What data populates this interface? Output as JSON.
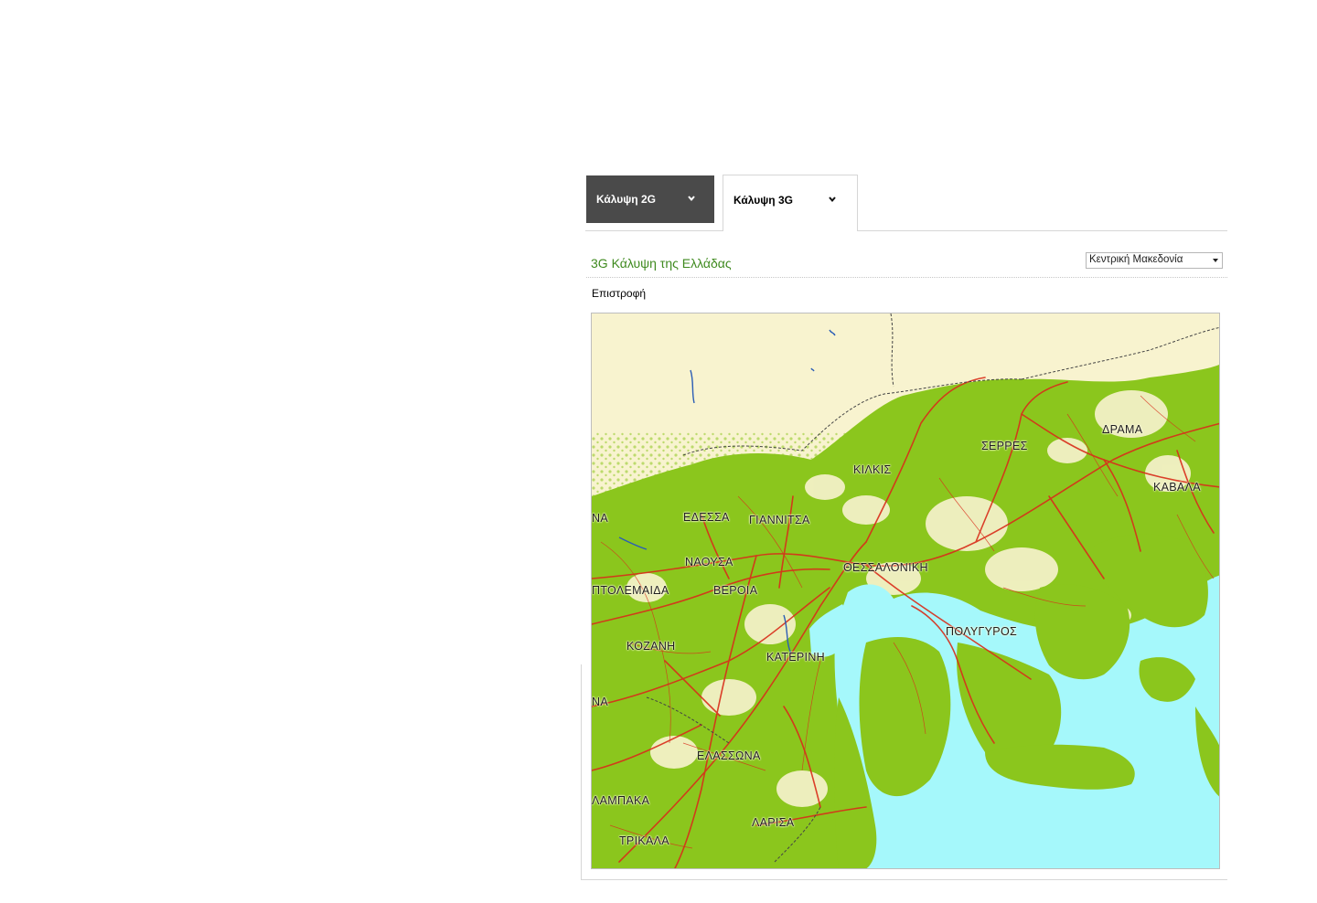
{
  "tabs": [
    {
      "label": "Κάλυψη 2G",
      "active": false
    },
    {
      "label": "Κάλυψη 3G",
      "active": true
    }
  ],
  "content": {
    "title": "3G Κάλυψη της Ελλάδας",
    "region_select": {
      "selected": "Κεντρική Μακεδονία"
    },
    "back_link": "Επιστροφή"
  },
  "map": {
    "colors": {
      "land": "#f8f3cf",
      "coverage": "#8bc61d",
      "sea": "#a5f8fb",
      "roads": "#d92d1a",
      "borders": "#444444",
      "lakes": "#2b5db5"
    },
    "labels": {
      "drama": "ΔΡΑΜΑ",
      "serres": "ΣΕΡΡΕΣ",
      "kilkis": "ΚΙΛΚΙΣ",
      "kavala": "ΚΑΒΑΛΑ",
      "na_top": "ΝΑ",
      "edessa": "ΕΔΕΣΣΑ",
      "giannitsa": "ΓΙΑΝΝΙΤΣΑ",
      "naousa": "ΝΑΟΥΣΑ",
      "thessaloniki": "ΘΕΣΣΑΛΟΝΙΚΗ",
      "ptolemaida": "ΠΤΟΛΕΜΑΙΔΑ",
      "veroia": "ΒΕΡΟΙΑ",
      "polygyros": "ΠΟΛΥΓΥΡΟΣ",
      "kozani": "ΚΟΖΑΝΗ",
      "katerini": "ΚΑΤΕΡΙΝΗ",
      "na_mid": "ΝΑ",
      "elassona": "ΕΛΑΣΣΩΝΑ",
      "lampaka": "ΛΑΜΠΑΚΑ",
      "larisa": "ΛΑΡΙΣΑ",
      "trikala": "ΤΡΙΚΑΛΑ"
    }
  }
}
